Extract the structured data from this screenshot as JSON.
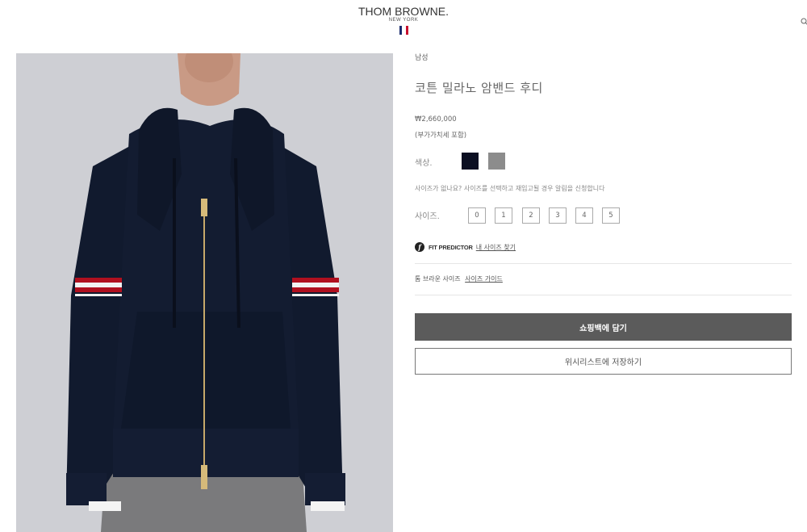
{
  "header": {
    "brand": "THOM BROWNE.",
    "sub": "NEW YORK",
    "flag_colors": [
      "#1a2a6c",
      "#ffffff",
      "#c8102e"
    ]
  },
  "product": {
    "image_icon": "product-photo-hoodie",
    "category": "남성",
    "title": "코튼 밀라노 암밴드 후디",
    "price": "₩2,660,000",
    "vat": "(부가가치세 포함)",
    "color_label": "색상.",
    "colors": [
      "#0b0f22",
      "#8c8c8c"
    ],
    "size_notice": "사이즈가 없나요? 사이즈를 선택하고 재입고될 경우 알림을 신청합니다",
    "size_label": "사이즈.",
    "sizes": [
      "0",
      "1",
      "2",
      "3",
      "4",
      "5"
    ],
    "fit_brand": "FIT PREDICTOR",
    "fit_link": "내 사이즈 찾기",
    "size_guide_prefix": "톰 브라운 사이즈",
    "size_guide_link": "사이즈 가이드",
    "add_to_bag": "쇼핑백에 담기",
    "wishlist": "위시리스트에 저장하기"
  }
}
